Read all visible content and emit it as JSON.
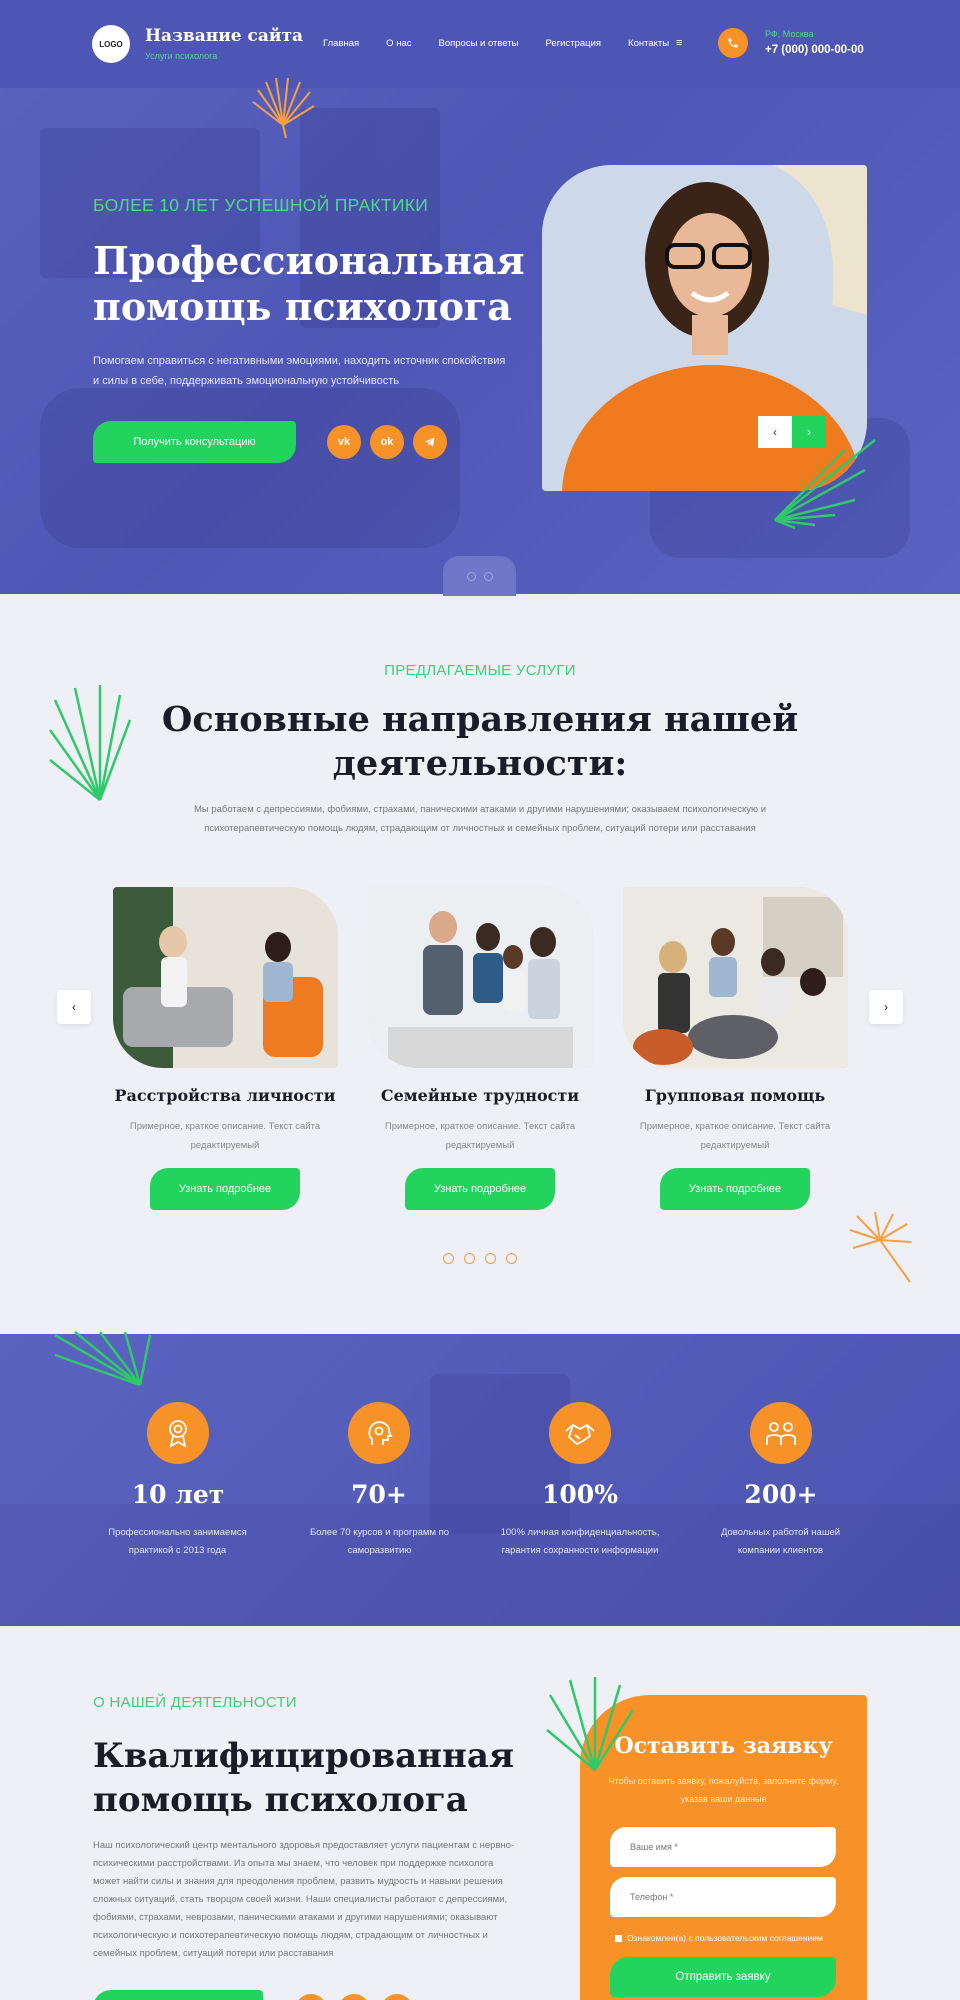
{
  "header": {
    "logo": "LOGO",
    "site_name": "Название сайта",
    "site_sub": "Услуги психолога",
    "nav": [
      "Главная",
      "О нас",
      "Вопросы и ответы",
      "Регистрация",
      "Контакты"
    ],
    "menu_icon": "≡",
    "city": "РФ, Москва",
    "phone": "+7 (000) 000-00-00",
    "icons": {
      "phone": "phone-icon",
      "menu": "menu-icon"
    }
  },
  "hero": {
    "kicker": "БОЛЕЕ 10 ЛЕТ УСПЕШНОЙ ПРАКТИКИ",
    "title": "Профессиональная помощь психолога",
    "text": "Помогаем справиться с негативными эмоциями, находить источник спокойствия и силы в себе, поддерживать эмоциональную устойчивость",
    "button": "Получить консультацию",
    "social": [
      "vk-icon",
      "odnoklassniki-icon",
      "telegram-icon"
    ],
    "prev": "‹",
    "next": "›"
  },
  "services": {
    "kicker": "ПРЕДЛАГАЕМЫЕ УСЛУГИ",
    "title": "Основные направления нашей деятельности:",
    "text": "Мы работаем с депрессиями, фобиями, страхами, паническими атаками и другими нарушениями; оказываем психологическую и психотерапевтическую помощь людям, страдающим от личностных и семейных проблем, ситуаций потери или расставания",
    "cards": [
      {
        "title": "Расстройства личности",
        "desc": "Примерное, краткое описание. Текст сайта редактируемый",
        "button": "Узнать подробнее"
      },
      {
        "title": "Семейные трудности",
        "desc": "Примерное, краткое описание. Текст сайта редактируемый",
        "button": "Узнать подробнее"
      },
      {
        "title": "Групповая помощь",
        "desc": "Примерное, краткое описание. Текст сайта редактируемый",
        "button": "Узнать подробнее"
      }
    ],
    "prev": "‹",
    "next": "›"
  },
  "stats": [
    {
      "value": "10 лет",
      "text": "Профессионально занимаемся практикой с 2013 года",
      "icon": "award-medal-icon"
    },
    {
      "value": "70+",
      "text": "Более 70 курсов и программ по саморазвитию",
      "icon": "head-gears-icon"
    },
    {
      "value": "100%",
      "text": "100% личная конфиденциальность, гарантия сохранности информации",
      "icon": "handshake-icon"
    },
    {
      "value": "200+",
      "text": "Довольных работой нашей компании клиентов",
      "icon": "group-people-icon"
    }
  ],
  "about": {
    "kicker": "О НАШЕЙ ДЕЯТЕЛЬНОСТИ",
    "title": "Квалифицированная помощь психолога",
    "text": "Наш психологический центр ментального здоровья предоставляет услуги пациентам с нервно-психическими расстройствами. Из опыта мы знаем, что человек при поддержке психолога может найти силы и знания для преодоления проблем, развить мудрость и навыки решения сложных ситуаций, стать творцом своей жизни. Наши специалисты работают с депрессиями, фобиями, страхами, неврозами, паническими атаками и другими нарушениями; оказывают психологическую и психотерапевтическую помощь людям, страдающим от личностных и семейных проблем, ситуаций потери или расставания"
  },
  "form": {
    "title": "Оставить заявку",
    "subtitle": "Чтобы оставить заявку, пожалуйста, заполните форму, указав ваши данные",
    "name_placeholder": "Ваше имя *",
    "phone_placeholder": "Телефон *",
    "agree": "Ознакомлен(а) с пользовательским соглашением",
    "button": "Отправить заявку"
  },
  "colors": {
    "accent_green": "#22d35d",
    "accent_orange": "#f79228",
    "brand_blue": "#4e56b5"
  }
}
